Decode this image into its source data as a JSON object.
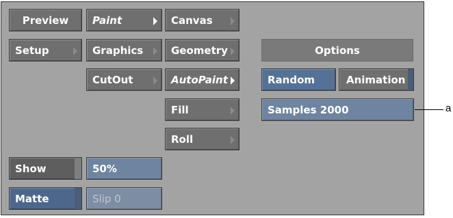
{
  "buttons": {
    "preview": "Preview",
    "setup": "Setup",
    "paint": "Paint",
    "graphics": "Graphics",
    "cutout": "CutOut",
    "canvas": "Canvas",
    "geometry": "Geometry",
    "autopaint": "AutoPaint",
    "fill": "Fill",
    "roll": "Roll",
    "show": "Show",
    "matte": "Matte",
    "random": "Random",
    "animation": "Animation"
  },
  "fields": {
    "zoom": "50%",
    "slip": "Slip 0",
    "samples": "Samples 2000"
  },
  "options_header": "Options",
  "callout_label": "a",
  "colors": {
    "panel": "#a3a3a3",
    "button_gray": "#6f6f6f",
    "button_blue": "#557195",
    "value_field": "#6f84a0"
  }
}
